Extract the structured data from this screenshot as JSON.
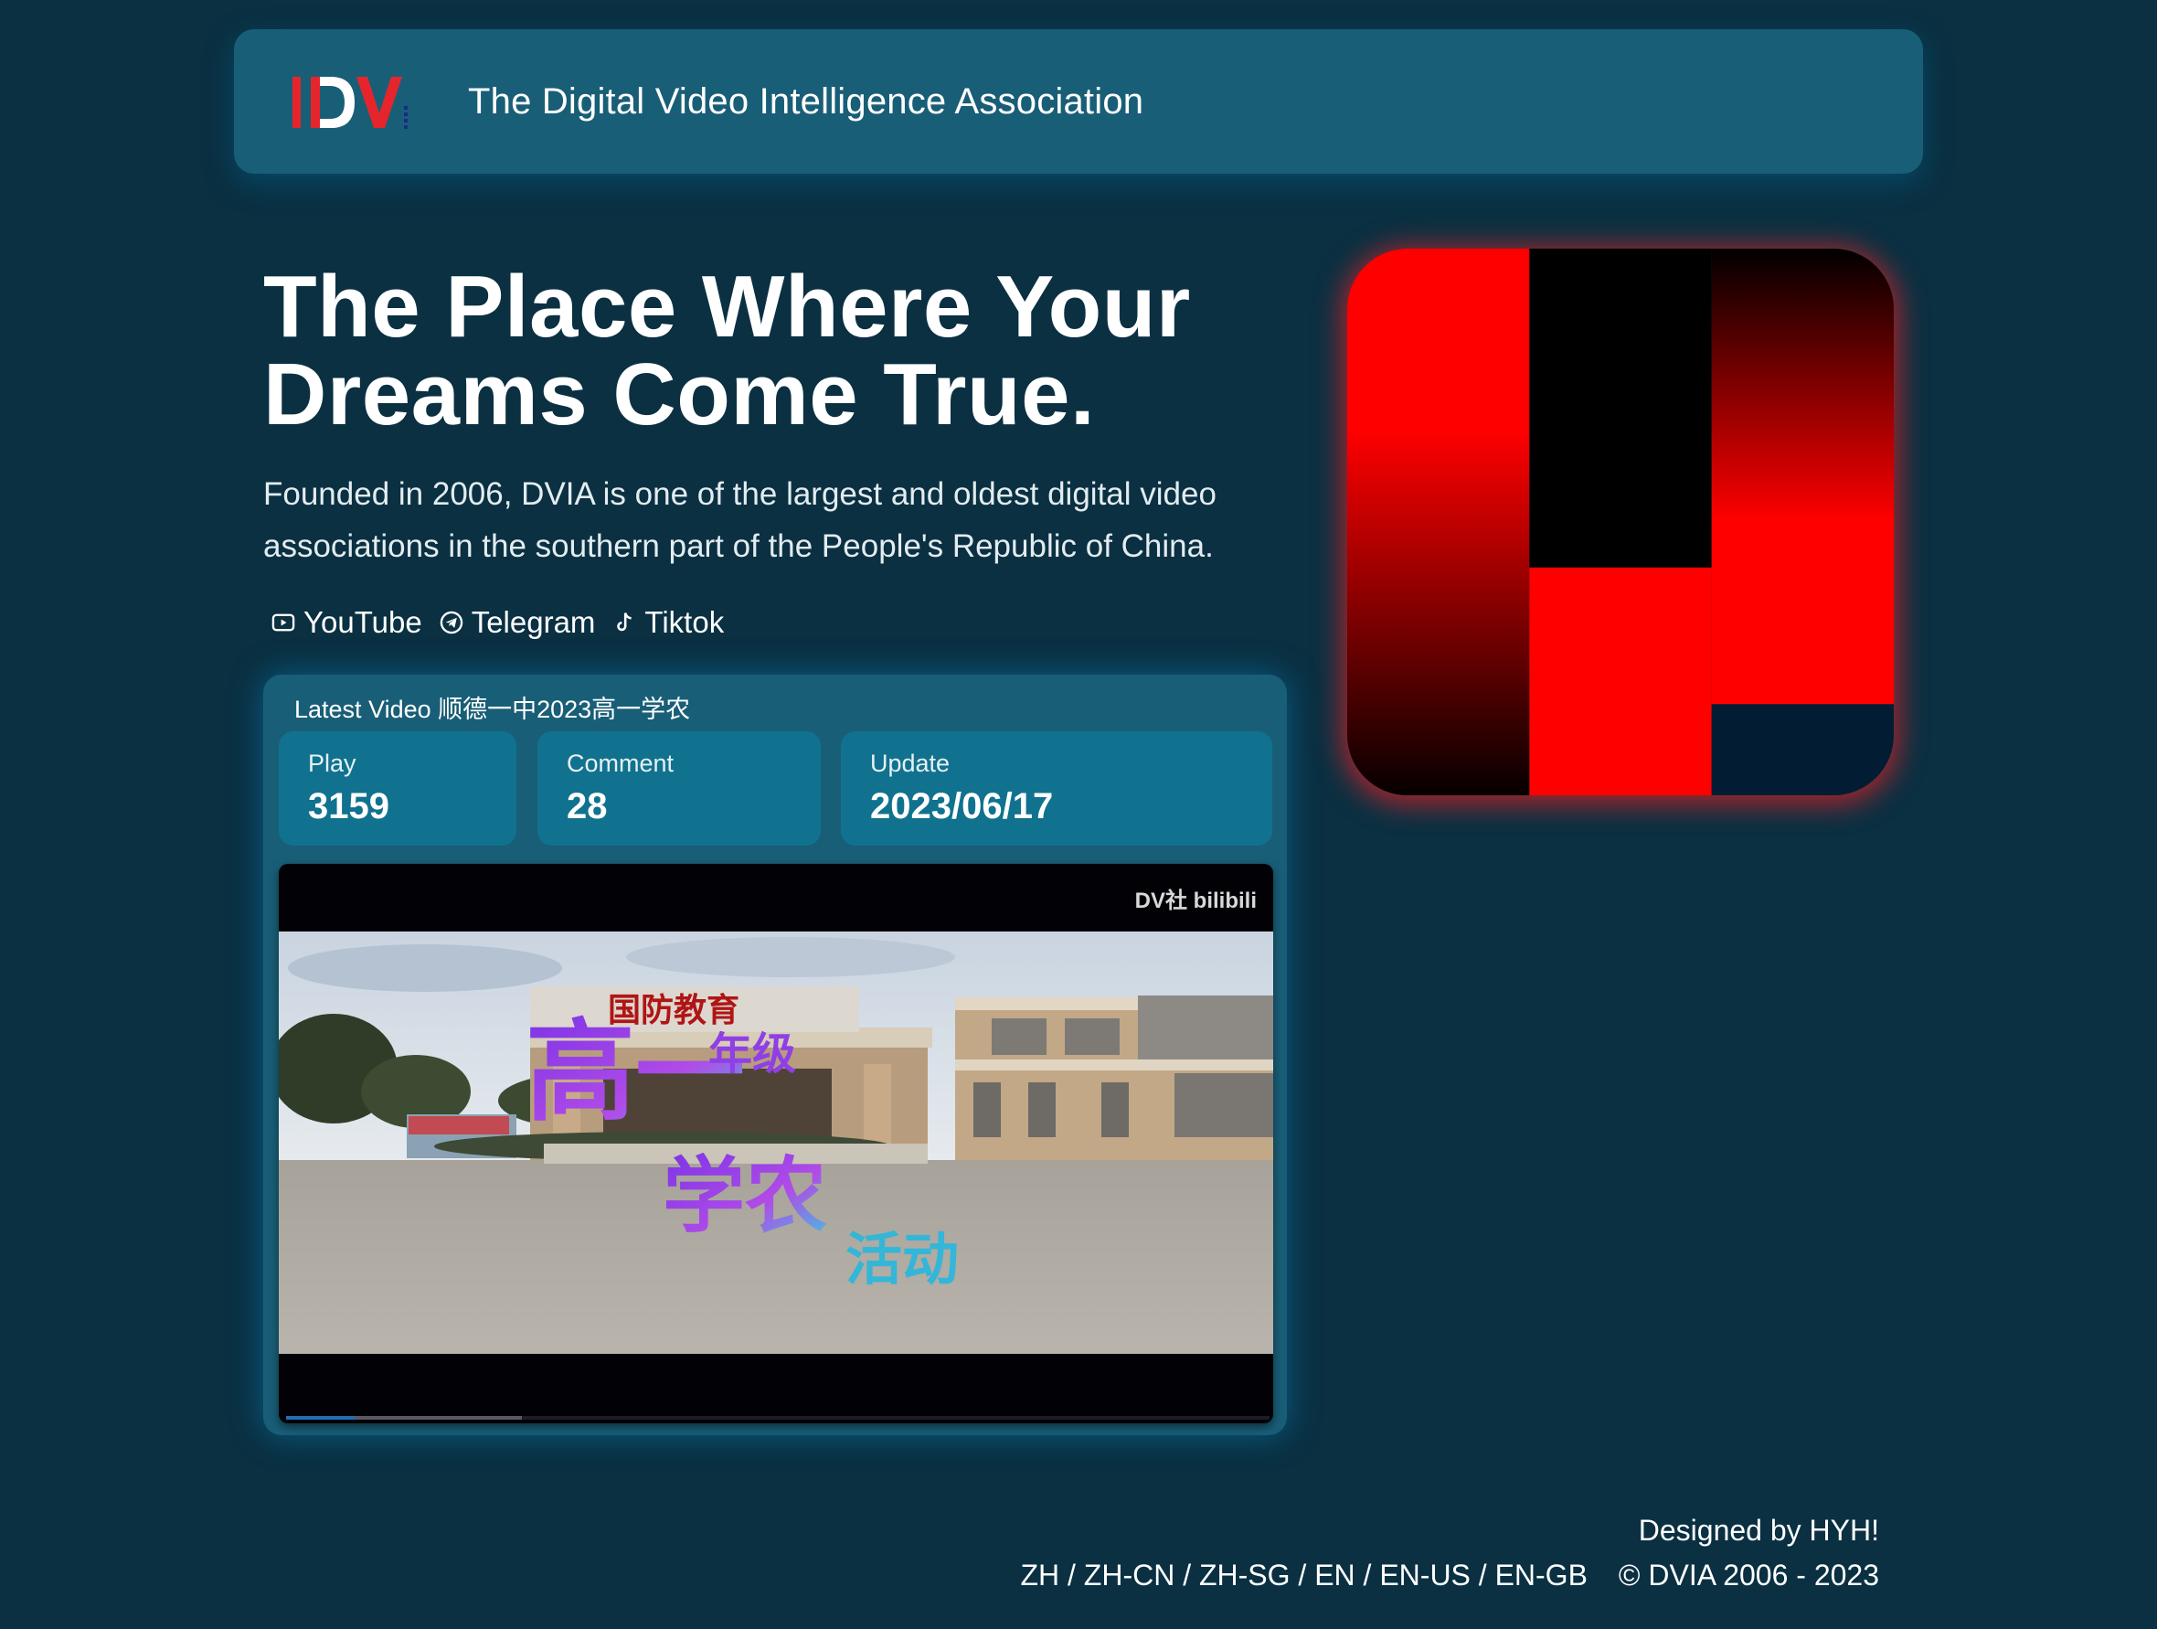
{
  "header": {
    "logo_text": "IDV.",
    "site_title": "The Digital Video Intelligence Association"
  },
  "hero": {
    "title": "The Place Where Your Dreams Come True.",
    "description": "Founded in 2006, DVIA is one of the largest and oldest digital video associations in the southern part of the People's Republic of China."
  },
  "social": [
    {
      "label": "YouTube",
      "icon": "youtube-icon"
    },
    {
      "label": "Telegram",
      "icon": "telegram-icon"
    },
    {
      "label": "Tiktok",
      "icon": "tiktok-icon"
    }
  ],
  "video": {
    "card_title": "Latest Video 顺德一中2023高一学农",
    "stats": {
      "play_label": "Play",
      "play_value": "3159",
      "comment_label": "Comment",
      "comment_value": "28",
      "update_label": "Update",
      "update_value": "2023/06/17"
    },
    "player": {
      "watermark": "DV社 bilibili",
      "banner_text": "国防教育",
      "overlay_text_big": "高一",
      "overlay_text_small": "年级",
      "overlay_text_mid": "学农",
      "overlay_text_tail": "活动",
      "progress_played": 0.07,
      "progress_buffered": 0.24
    }
  },
  "footer": {
    "credit": "Designed by HYH!",
    "languages": [
      "ZH",
      "ZH-CN",
      "ZH-SG",
      "EN",
      "EN-US",
      "EN-GB"
    ],
    "separator": " / ",
    "copyright": "© DVIA 2006 - 2023"
  },
  "colors": {
    "page_bg": "#0a3042",
    "header_bg": "#195e77",
    "stat_bg": "#10728f",
    "logo_red": "#e5252b",
    "art_red": "#ff0000",
    "art_black": "#000000",
    "art_navy": "#021c33"
  }
}
